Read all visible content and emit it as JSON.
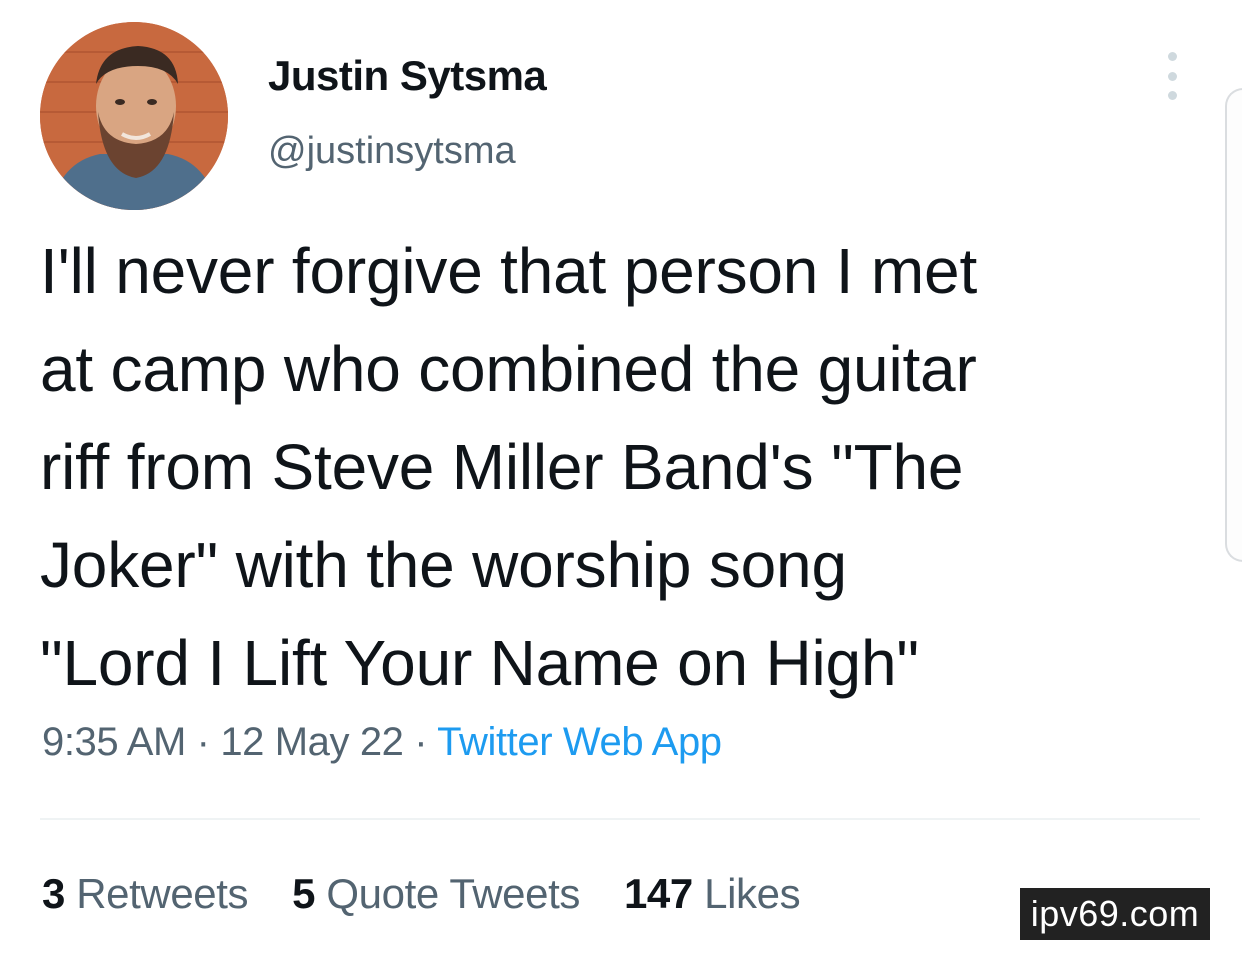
{
  "author": {
    "display_name": "Justin Sytsma",
    "handle": "@justinsytsma"
  },
  "tweet": {
    "text": "I'll never forgive that person I met\nat camp who combined the guitar\nriff from Steve Miller Band's \"The\nJoker\" with the worship song\n\"Lord I Lift Your Name on High\"",
    "time": "9:35 AM",
    "date": "12 May 22",
    "source": "Twitter Web App",
    "separator": " · "
  },
  "stats": {
    "retweets": {
      "count": "3",
      "label": "Retweets"
    },
    "quote_tweets": {
      "count": "5",
      "label": "Quote Tweets"
    },
    "likes": {
      "count": "147",
      "label": "Likes"
    }
  },
  "watermark": "ipv69.com",
  "icons": {
    "more": "more-vertical-icon",
    "avatar": "avatar-photo"
  },
  "colors": {
    "text": "#0f1419",
    "secondary": "#536471",
    "link": "#1d9bf0",
    "divider": "#eff3f4"
  }
}
